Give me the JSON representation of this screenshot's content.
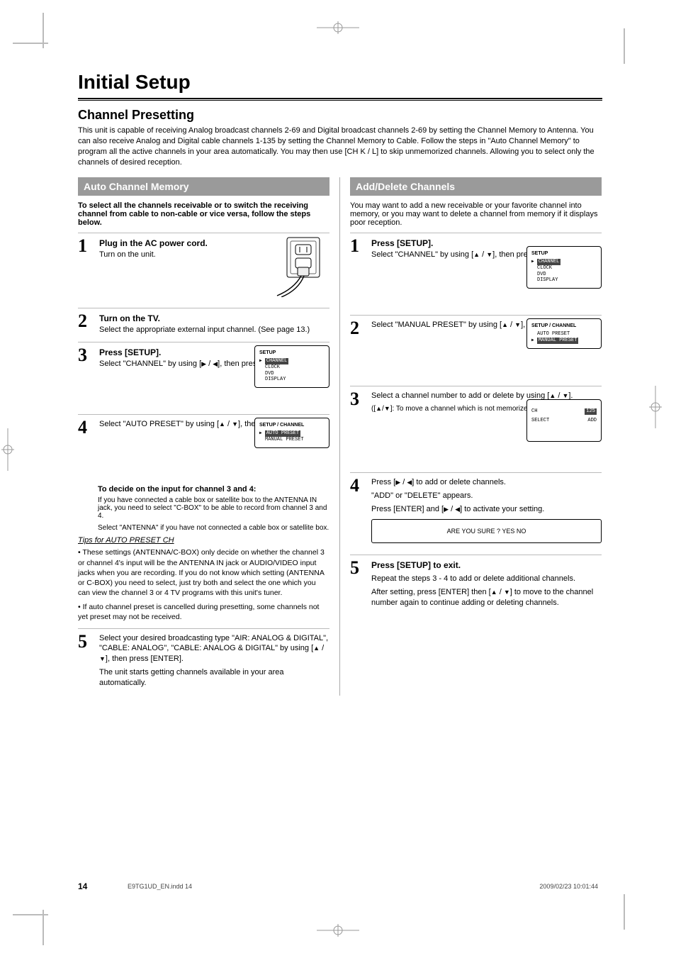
{
  "page_title": "Initial Setup",
  "subtitle": "Channel Presetting",
  "intro": "This unit is capable of receiving Analog broadcast channels 2-69 and Digital broadcast channels 2-69 by setting the Channel Memory to Antenna. You can also receive Analog and Digital cable channels 1-135 by setting the Channel Memory to Cable. Follow the steps in \"Auto Channel Memory\" to program all the active channels in your area automatically. You may then use [CH K / L] to skip unmemorized channels. Allowing you to select only the channels of desired reception.",
  "sections": {
    "auto": {
      "title": "Auto Channel Memory",
      "lead": "To select all the channels receivable or to switch the receiving channel from cable to non-cable or vice versa, follow the steps below.",
      "step1": {
        "num": "1",
        "title": "Plug in the AC power cord.",
        "body": "Turn on the unit."
      },
      "step2": {
        "num": "2",
        "title": "Turn on the TV.",
        "body": "Select the appropriate external input channel. (See page 13.)"
      },
      "step3": {
        "num": "3",
        "title": "Press [SETUP].",
        "body_before": "Select \"CHANNEL\" by using [",
        "body_after": "], then press [ENTER].",
        "arrow1": "B",
        "slash": " / ",
        "arrow2": "s",
        "screen": {
          "hdr": "SETUP",
          "items": [
            "CHANNEL",
            "CLOCK",
            "DVD",
            "DISPLAY"
          ],
          "highlight": 0
        }
      },
      "step4": {
        "num": "4",
        "body_pre": "Select \"AUTO PRESET\" by using [",
        "arrow1": "K",
        "slash": " / ",
        "arrow2": "L",
        "mid": "], then press [",
        "arrow3": "B",
        "body_post": "].",
        "screen": {
          "hdr": "SETUP / CHANNEL",
          "items": [
            "AUTO PRESET",
            "MANUAL PRESET"
          ],
          "highlight": 0
        },
        "sub_q": "To decide on the input for channel 3 and 4:",
        "sub_body1": "If you have connected a cable box or satellite box to the ANTENNA IN jack, you need to select \"C-BOX\" to be able to record from channel 3 and 4.",
        "sub_body2": "Select \"ANTENNA\" if you have not connected a cable box or satellite box.",
        "tips_title": "Tips for AUTO PRESET CH",
        "tip1": "These settings (ANTENNA/C-BOX) only decide on whether the channel 3 or channel 4's input will be the ANTENNA IN jack or AUDIO/VIDEO input jacks when you are recording. If you do not know which setting (ANTENNA or C-BOX) you need to select, just try both and select the one which you can view the channel 3 or 4 TV programs with this unit's tuner.",
        "tip2": "If auto channel preset is cancelled during presetting, some channels not yet preset may not be received.",
        "rule_break": true
      },
      "step5": {
        "num": "5",
        "body_pre": "Select your desired broadcasting type \"AIR: ANALOG & DIGITAL\", \"CABLE: ANALOG\", \"CABLE: ANALOG & DIGITAL\" by using [",
        "arrow1": "K",
        "slash": " / ",
        "arrow2": "L",
        "body_mid": "], then press [ENTER].",
        "body_post": "The unit starts getting channels available in your area automatically."
      }
    },
    "manual": {
      "title": "Add/Delete Channels",
      "lead": "You may want to add a new receivable or your favorite channel into memory, or you may want to delete a channel from memory if it displays poor reception.",
      "step1": {
        "num": "1",
        "body_setup": "Press [SETUP].",
        "body_pre": "Select \"CHANNEL\" by using [",
        "arrow1": "K",
        "slash1": " / ",
        "arrow2": "L",
        "body_mid": "], then press [",
        "arrow3": "B",
        "body_post": "].",
        "screen": {
          "hdr": "SETUP",
          "items": [
            "CHANNEL",
            "CLOCK",
            "DVD",
            "DISPLAY"
          ],
          "highlight": 0
        }
      },
      "step2": {
        "num": "2",
        "body_pre": "Select \"MANUAL PRESET\" by using [",
        "arrow1": "K",
        "slash": " / ",
        "arrow2": "L",
        "mid": "], then press [",
        "arrow3": "B",
        "body_post": "].",
        "screen": {
          "hdr": "SETUP / CHANNEL",
          "items": [
            "AUTO PRESET",
            "MANUAL PRESET"
          ],
          "highlight": 1
        }
      },
      "step3": {
        "num": "3",
        "body_pre": "Select a channel number to add or delete by using [",
        "arrow1": "K",
        "slash": " / ",
        "arrow2": "L",
        "mid1": "].",
        "note_pre": "([",
        "arrow3": "K",
        "note_slash": "/",
        "arrow4": "L",
        "note_post": "]: To move a channel which is not memorized yet.)",
        "screen_rows": [
          {
            "label": "CH",
            "val": "125"
          },
          {
            "label": "SELECT",
            "val": "ADD"
          }
        ]
      },
      "step4": {
        "num": "4",
        "body_pre": "Press [",
        "arrow1": "B",
        "slash": " / ",
        "arrow2": "s",
        "body_post": "] to add or delete channels.",
        "line2": "\"ADD\" or \"DELETE\" appears.",
        "line3_pre": "Press [ENTER] and [",
        "arrow3": "B",
        "slash3": " / ",
        "arrow4": "s",
        "line3_post": "] to activate your setting.",
        "dialog": "ARE YOU SURE ?   YES   NO"
      },
      "step5": {
        "num": "5",
        "body_pre": "Press [SETUP] to exit.",
        "body1": "Repeat the steps 3 - 4 to add or delete additional channels.",
        "body2_pre": "After setting, press [ENTER] then [",
        "arrow1": "K",
        "slash": " / ",
        "arrow2": "L",
        "body2_post": "] to move to the channel number again to continue adding or deleting channels."
      }
    }
  },
  "footer": {
    "page_num": "14",
    "file": "E9TG1UD_EN.indd   14",
    "timestamp": "2009/02/23   10:01:44"
  }
}
